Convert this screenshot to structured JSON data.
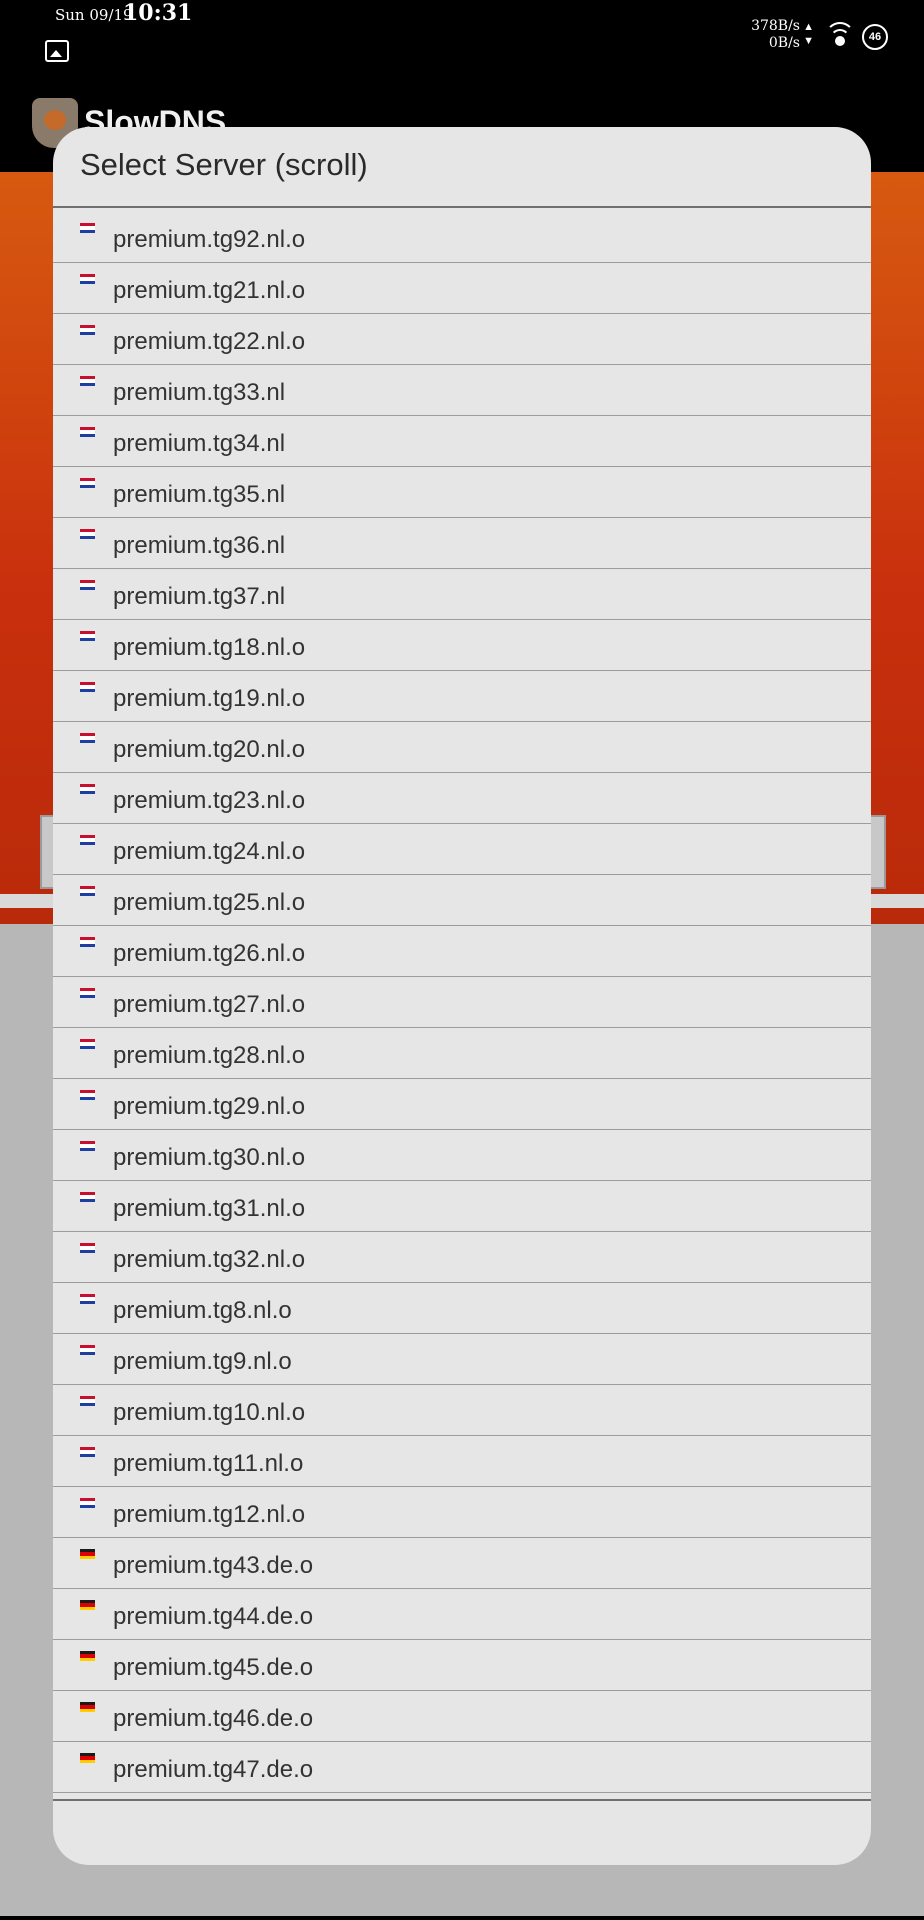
{
  "status_bar": {
    "date": "Sun 09/19",
    "time": "10:31",
    "speed_up": "378B/s",
    "speed_down": "0B/s",
    "signal": "46"
  },
  "app": {
    "title": "SlowDNS"
  },
  "dialog": {
    "title": "Select Server (scroll)",
    "servers": [
      {
        "label": "premium.tg92.nl.o",
        "flag": "nl"
      },
      {
        "label": "premium.tg21.nl.o",
        "flag": "nl"
      },
      {
        "label": "premium.tg22.nl.o",
        "flag": "nl"
      },
      {
        "label": "premium.tg33.nl",
        "flag": "nl"
      },
      {
        "label": "premium.tg34.nl",
        "flag": "nl"
      },
      {
        "label": "premium.tg35.nl",
        "flag": "nl"
      },
      {
        "label": "premium.tg36.nl",
        "flag": "nl"
      },
      {
        "label": "premium.tg37.nl",
        "flag": "nl"
      },
      {
        "label": "premium.tg18.nl.o",
        "flag": "nl"
      },
      {
        "label": "premium.tg19.nl.o",
        "flag": "nl"
      },
      {
        "label": "premium.tg20.nl.o",
        "flag": "nl"
      },
      {
        "label": "premium.tg23.nl.o",
        "flag": "nl"
      },
      {
        "label": "premium.tg24.nl.o",
        "flag": "nl"
      },
      {
        "label": "premium.tg25.nl.o",
        "flag": "nl"
      },
      {
        "label": "premium.tg26.nl.o",
        "flag": "nl"
      },
      {
        "label": "premium.tg27.nl.o",
        "flag": "nl"
      },
      {
        "label": "premium.tg28.nl.o",
        "flag": "nl"
      },
      {
        "label": "premium.tg29.nl.o",
        "flag": "nl"
      },
      {
        "label": "premium.tg30.nl.o",
        "flag": "nl"
      },
      {
        "label": "premium.tg31.nl.o",
        "flag": "nl"
      },
      {
        "label": "premium.tg32.nl.o",
        "flag": "nl"
      },
      {
        "label": "premium.tg8.nl.o",
        "flag": "nl"
      },
      {
        "label": "premium.tg9.nl.o",
        "flag": "nl"
      },
      {
        "label": "premium.tg10.nl.o",
        "flag": "nl"
      },
      {
        "label": "premium.tg11.nl.o",
        "flag": "nl"
      },
      {
        "label": "premium.tg12.nl.o",
        "flag": "nl"
      },
      {
        "label": "premium.tg43.de.o",
        "flag": "de"
      },
      {
        "label": "premium.tg44.de.o",
        "flag": "de"
      },
      {
        "label": "premium.tg45.de.o",
        "flag": "de"
      },
      {
        "label": "premium.tg46.de.o",
        "flag": "de"
      },
      {
        "label": "premium.tg47.de.o",
        "flag": "de"
      }
    ]
  },
  "flags": {
    "nl": [
      "#c8102e",
      "#ffffff",
      "#1e3fa0"
    ],
    "de": [
      "#1a1a1a",
      "#dd0000",
      "#ffce00"
    ]
  },
  "colors": {
    "accent": "#d75a10"
  }
}
